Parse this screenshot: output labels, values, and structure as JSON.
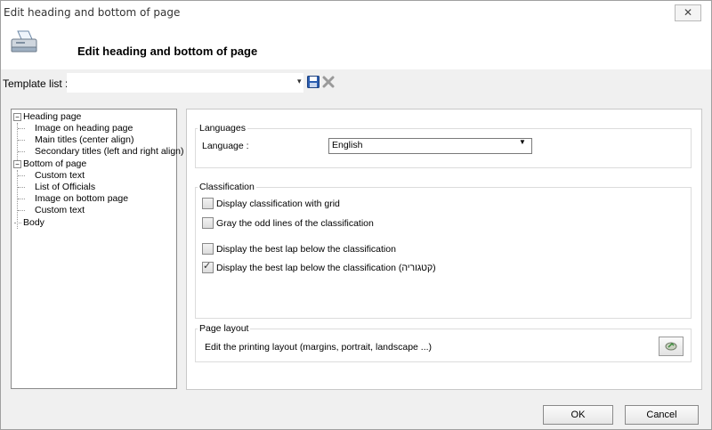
{
  "window": {
    "title": "Edit heading and bottom of page",
    "close_glyph": "✕"
  },
  "header": {
    "title": "Edit heading and bottom of page"
  },
  "template": {
    "label": "Template list :",
    "value": ""
  },
  "tree": {
    "nodes": [
      {
        "label": "Heading page"
      },
      {
        "label": "Image on heading page"
      },
      {
        "label": "Main titles (center align)"
      },
      {
        "label": "Secondary titles (left and right align)"
      },
      {
        "label": "Bottom of page"
      },
      {
        "label": "Custom text"
      },
      {
        "label": "List of Officials"
      },
      {
        "label": "Image on bottom page"
      },
      {
        "label": "Custom text"
      },
      {
        "label": "Body"
      }
    ]
  },
  "languages": {
    "group_title": "Languages",
    "label": "Language :",
    "selected": "English"
  },
  "classification": {
    "group_title": "Classification",
    "options": [
      {
        "label": "Display classification with grid",
        "checked": false
      },
      {
        "label": "Gray the odd lines of the classification",
        "checked": false
      },
      {
        "label": "Display the best lap below the classification",
        "checked": false
      },
      {
        "label": "Display the best lap below the classification (קטגוריה)",
        "checked": true
      }
    ]
  },
  "page_layout": {
    "group_title": "Page layout",
    "description": "Edit the printing layout (margins, portrait, landscape ...)"
  },
  "buttons": {
    "ok": "OK",
    "cancel": "Cancel"
  },
  "colors": {
    "save_icon": "#2a5db0",
    "delete_icon": "#9a9a9a"
  }
}
